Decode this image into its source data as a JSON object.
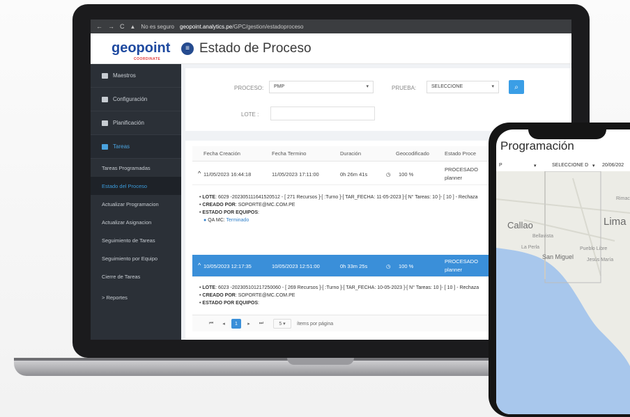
{
  "browser": {
    "security": "No es seguro",
    "url_host": "geopoint.analytics.pe",
    "url_path": "/GPC/gestion/estadoproceso"
  },
  "header": {
    "logo": "geopoint",
    "logo_sub": "COORDINATE",
    "title": "Estado de Proceso"
  },
  "sidebar": {
    "items": [
      {
        "label": "Maestros"
      },
      {
        "label": "Configuración"
      },
      {
        "label": "Planificación"
      },
      {
        "label": "Tareas"
      }
    ],
    "sub_items": [
      {
        "label": "Tareas Programadas"
      },
      {
        "label": "Estado del Proceso"
      },
      {
        "label": "Actualizar Programacion"
      },
      {
        "label": "Actualizar Asignacion"
      },
      {
        "label": "Seguimiento de Tareas"
      },
      {
        "label": "Seguimiento por Equipo"
      },
      {
        "label": "Cierre de Tareas"
      }
    ],
    "reportes": "> Reportes"
  },
  "filters": {
    "proceso_label": "PROCESO:",
    "proceso_value": "PMP",
    "prueba_label": "PRUEBA:",
    "prueba_value": "SELECCIONE",
    "lote_label": "LOTE :"
  },
  "table": {
    "headers": [
      "Fecha Creación",
      "Fecha Termino",
      "Duración",
      "Geocodificado",
      "Estado Proce"
    ],
    "rows": [
      {
        "creacion": "11/05/2023 16:44:18",
        "termino": "11/05/2023 17:11:00",
        "duracion": "0h 26m 41s",
        "geocod": "100 %",
        "estado": "PROCESADO planner"
      },
      {
        "creacion": "10/05/2023 12:17:35",
        "termino": "10/05/2023 12:51:00",
        "duracion": "0h 33m 25s",
        "geocod": "100 %",
        "estado": "PROCESADO planner"
      }
    ],
    "detail1": {
      "lote_label": "LOTE",
      "lote_text": ": 6029 -20230511164152051​2 - [ 271 Recursos ]-[ :Turno ]-[ TAR_FECHA: 11-05-2023 ]-[ N° Tareas: 10 ]- [ 10 ] - Rechaza",
      "creado_label": "CREADO POR",
      "creado_text": ": SOPORTE@MC.COM.PE",
      "estado_label": "ESTADO POR EQUIPOS",
      "qa_label": "QA MC:",
      "qa_status": "Terminado"
    },
    "detail2": {
      "lote_label": "LOTE",
      "lote_text": ": 6023 -20230510121725006​0 - [ 269 Recursos ]-[ :Turno ]-[ TAR_FECHA: 10-05-2023 ]-[ N° Tareas: 10 ]- [ 10 ] - Rechaza",
      "creado_label": "CREADO POR",
      "creado_text": ": SOPORTE@MC.COM.PE",
      "estado_label": "ESTADO POR EQUIPOS"
    },
    "pager": {
      "current_page": "1",
      "per_page": "5",
      "per_page_label": "ítems por página"
    }
  },
  "phone": {
    "title": "Programación",
    "filter_left": "P",
    "filter_mid": "SELECCIONE D",
    "filter_right": "20/06/202",
    "map_labels": [
      "Callao",
      "Lima",
      "Bellavista",
      "La Perla",
      "San Miguel",
      "Pueblo Libre",
      "Jesús María",
      "Rimac"
    ]
  }
}
